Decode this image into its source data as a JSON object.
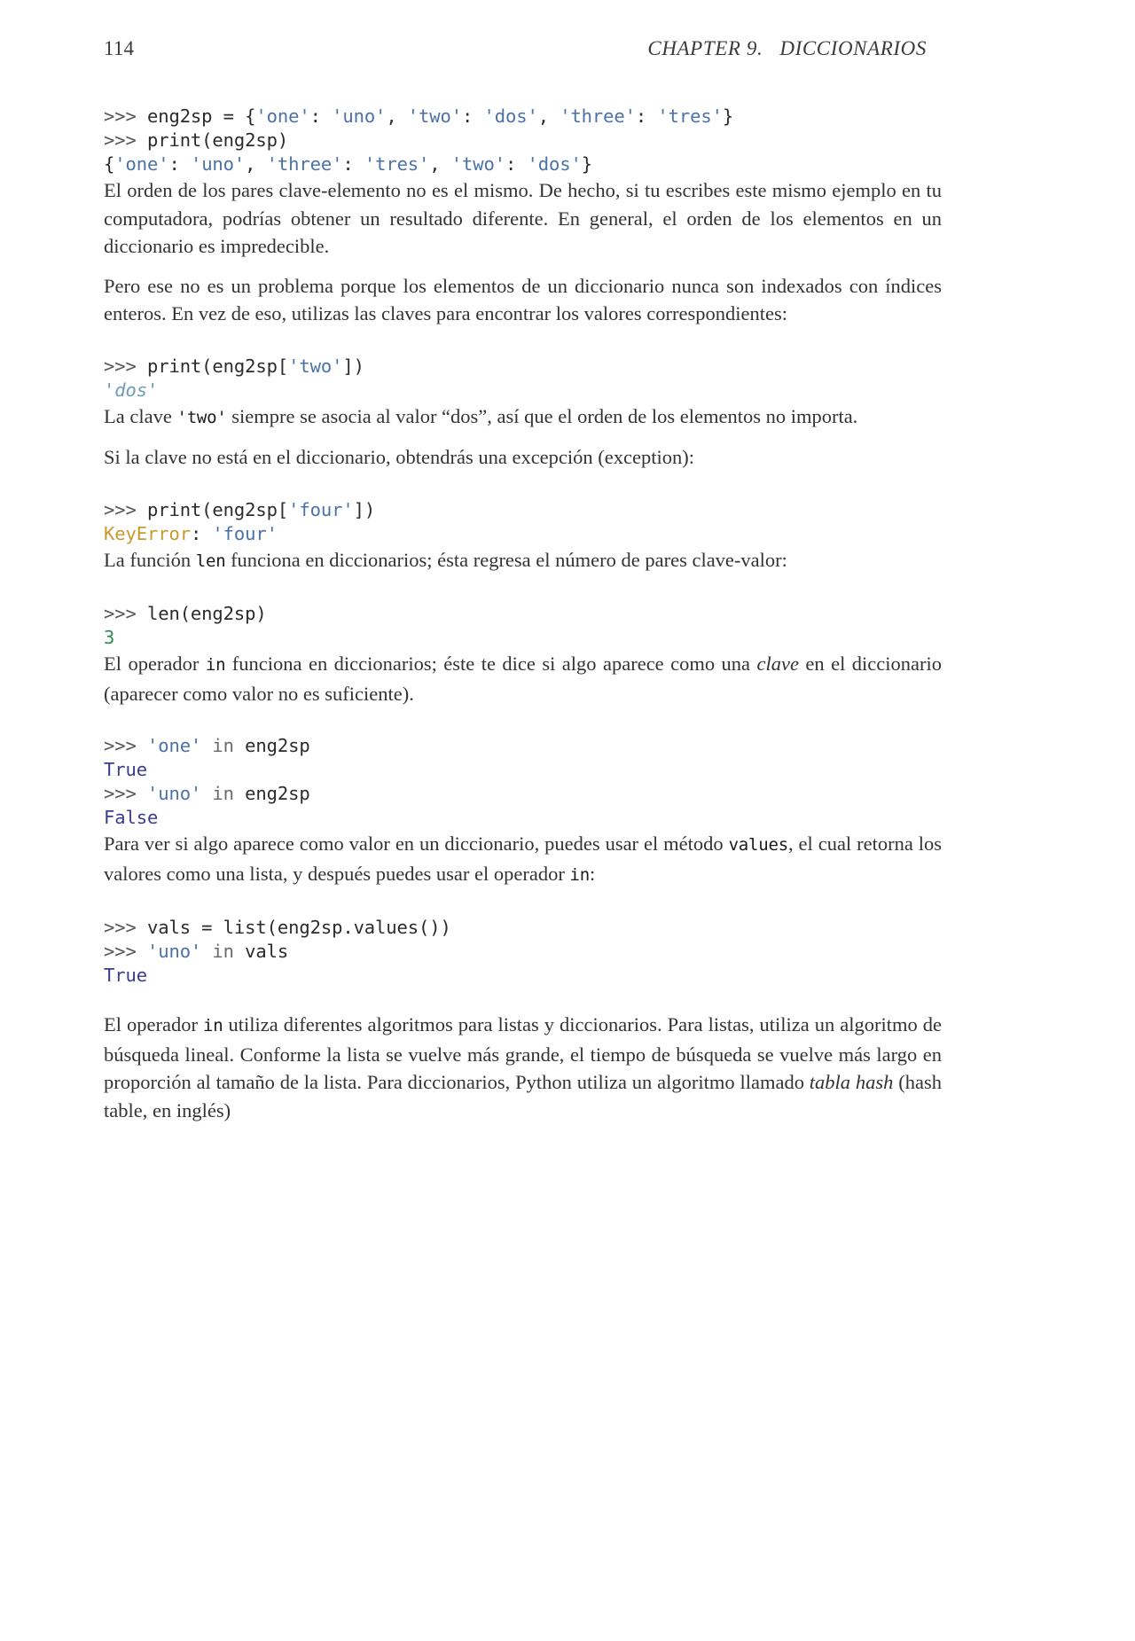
{
  "page": {
    "folio": "114",
    "running_head": "CHAPTER 9.   DICCIONARIOS"
  },
  "blocks": {
    "code1": {
      "line1_prompt": ">>> ",
      "line1_a": "eng2sp = {",
      "line1_s1": "'one'",
      "line1_b": ": ",
      "line1_s2": "'uno'",
      "line1_c": ", ",
      "line1_s3": "'two'",
      "line1_d": ": ",
      "line1_s4": "'dos'",
      "line1_e": ", ",
      "line1_s5": "'three'",
      "line1_f": ": ",
      "line1_s6": "'tres'",
      "line1_g": "}",
      "line2_prompt": ">>> ",
      "line2_a": "print(eng2sp)",
      "line3_a": "{",
      "line3_s1": "'one'",
      "line3_b": ": ",
      "line3_s2": "'uno'",
      "line3_c": ", ",
      "line3_s3": "'three'",
      "line3_d": ": ",
      "line3_s4": "'tres'",
      "line3_e": ", ",
      "line3_s5": "'two'",
      "line3_f": ": ",
      "line3_s6": "'dos'",
      "line3_g": "}"
    },
    "para1": "El orden de los pares clave-elemento no es el mismo. De hecho, si tu escribes este mismo ejemplo en tu computadora, podrías obtener un resultado diferente. En general, el orden de los elementos en un diccionario es impredecible.",
    "para2": "Pero ese no es un problema porque los elementos de un diccionario nunca son indexados con índices enteros. En vez de eso, utilizas las claves para encontrar los valores correspondientes:",
    "code2": {
      "line1_prompt": ">>> ",
      "line1_a": "print(eng2sp[",
      "line1_s1": "'two'",
      "line1_b": "])",
      "line2_out": "'dos'"
    },
    "para3_a": "La clave ",
    "para3_code": "'two'",
    "para3_b": " siempre se asocia al valor “dos”, así que el orden de los elementos no importa.",
    "para4": "Si la clave no está en el diccionario, obtendrás una excepción (exception):",
    "code3": {
      "line1_prompt": ">>> ",
      "line1_a": "print(eng2sp[",
      "line1_s1": "'four'",
      "line1_b": "])",
      "line2_err": "KeyError",
      "line2_colon": ": ",
      "line2_s": "'four'"
    },
    "para5_a": "La función ",
    "para5_code": "len",
    "para5_b": " funciona en diccionarios; ésta regresa el número de pares clave-valor:",
    "code4": {
      "line1_prompt": ">>> ",
      "line1_a": "len(eng2sp)",
      "line2_num": "3"
    },
    "para6_a": "El operador ",
    "para6_code": "in",
    "para6_b": " funciona en diccionarios; éste te dice si algo aparece como una ",
    "para6_ital": "clave",
    "para6_c": " en el diccionario (aparecer como valor no es suficiente).",
    "code5": {
      "line1_prompt": ">>> ",
      "line1_s": "'one'",
      "line1_kw": " in ",
      "line1_a": "eng2sp",
      "line2_bool": "True",
      "line3_prompt": ">>> ",
      "line3_s": "'uno'",
      "line3_kw": " in ",
      "line3_a": "eng2sp",
      "line4_bool": "False"
    },
    "para7_a": "Para ver si algo aparece como valor en un diccionario, puedes usar el método ",
    "para7_code1": "values",
    "para7_b": ", el cual retorna los valores como una lista, y después puedes usar el operador ",
    "para7_code2": "in",
    "para7_c": ":",
    "code6": {
      "line1_prompt": ">>> ",
      "line1_a": "vals = list(eng2sp.values())",
      "line2_prompt": ">>> ",
      "line2_s": "'uno'",
      "line2_kw": " in ",
      "line2_a": "vals",
      "line3_bool": "True"
    },
    "para8_a": "El operador ",
    "para8_code": "in",
    "para8_b": " utiliza diferentes algoritmos para listas y diccionarios. Para listas, utiliza un algoritmo de búsqueda lineal. Conforme la lista se vuelve más grande, el tiempo de búsqueda se vuelve más largo en proporción al tamaño de la lista. Para diccionarios, Python utiliza un algoritmo llamado ",
    "para8_ital": "tabla hash",
    "para8_c": " (hash table, en inglés)"
  },
  "colors": {
    "text": "#333333",
    "string": "#4a72a8",
    "output_string": "#6b9bb5",
    "error": "#c9992e",
    "number": "#2e8b57",
    "boolean": "#3b3b8f",
    "prompt": "#555555"
  }
}
